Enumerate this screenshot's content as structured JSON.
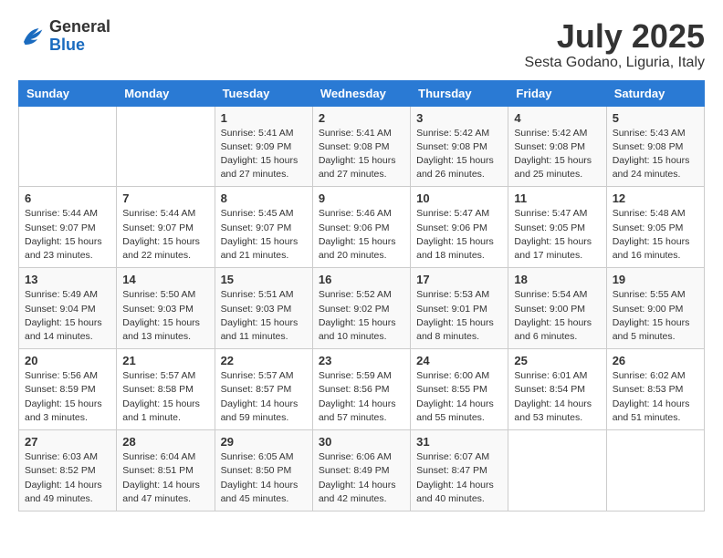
{
  "header": {
    "logo_general": "General",
    "logo_blue": "Blue",
    "month_title": "July 2025",
    "location": "Sesta Godano, Liguria, Italy"
  },
  "weekdays": [
    "Sunday",
    "Monday",
    "Tuesday",
    "Wednesday",
    "Thursday",
    "Friday",
    "Saturday"
  ],
  "weeks": [
    [
      {
        "day": "",
        "info": ""
      },
      {
        "day": "",
        "info": ""
      },
      {
        "day": "1",
        "info": "Sunrise: 5:41 AM\nSunset: 9:09 PM\nDaylight: 15 hours\nand 27 minutes."
      },
      {
        "day": "2",
        "info": "Sunrise: 5:41 AM\nSunset: 9:08 PM\nDaylight: 15 hours\nand 27 minutes."
      },
      {
        "day": "3",
        "info": "Sunrise: 5:42 AM\nSunset: 9:08 PM\nDaylight: 15 hours\nand 26 minutes."
      },
      {
        "day": "4",
        "info": "Sunrise: 5:42 AM\nSunset: 9:08 PM\nDaylight: 15 hours\nand 25 minutes."
      },
      {
        "day": "5",
        "info": "Sunrise: 5:43 AM\nSunset: 9:08 PM\nDaylight: 15 hours\nand 24 minutes."
      }
    ],
    [
      {
        "day": "6",
        "info": "Sunrise: 5:44 AM\nSunset: 9:07 PM\nDaylight: 15 hours\nand 23 minutes."
      },
      {
        "day": "7",
        "info": "Sunrise: 5:44 AM\nSunset: 9:07 PM\nDaylight: 15 hours\nand 22 minutes."
      },
      {
        "day": "8",
        "info": "Sunrise: 5:45 AM\nSunset: 9:07 PM\nDaylight: 15 hours\nand 21 minutes."
      },
      {
        "day": "9",
        "info": "Sunrise: 5:46 AM\nSunset: 9:06 PM\nDaylight: 15 hours\nand 20 minutes."
      },
      {
        "day": "10",
        "info": "Sunrise: 5:47 AM\nSunset: 9:06 PM\nDaylight: 15 hours\nand 18 minutes."
      },
      {
        "day": "11",
        "info": "Sunrise: 5:47 AM\nSunset: 9:05 PM\nDaylight: 15 hours\nand 17 minutes."
      },
      {
        "day": "12",
        "info": "Sunrise: 5:48 AM\nSunset: 9:05 PM\nDaylight: 15 hours\nand 16 minutes."
      }
    ],
    [
      {
        "day": "13",
        "info": "Sunrise: 5:49 AM\nSunset: 9:04 PM\nDaylight: 15 hours\nand 14 minutes."
      },
      {
        "day": "14",
        "info": "Sunrise: 5:50 AM\nSunset: 9:03 PM\nDaylight: 15 hours\nand 13 minutes."
      },
      {
        "day": "15",
        "info": "Sunrise: 5:51 AM\nSunset: 9:03 PM\nDaylight: 15 hours\nand 11 minutes."
      },
      {
        "day": "16",
        "info": "Sunrise: 5:52 AM\nSunset: 9:02 PM\nDaylight: 15 hours\nand 10 minutes."
      },
      {
        "day": "17",
        "info": "Sunrise: 5:53 AM\nSunset: 9:01 PM\nDaylight: 15 hours\nand 8 minutes."
      },
      {
        "day": "18",
        "info": "Sunrise: 5:54 AM\nSunset: 9:00 PM\nDaylight: 15 hours\nand 6 minutes."
      },
      {
        "day": "19",
        "info": "Sunrise: 5:55 AM\nSunset: 9:00 PM\nDaylight: 15 hours\nand 5 minutes."
      }
    ],
    [
      {
        "day": "20",
        "info": "Sunrise: 5:56 AM\nSunset: 8:59 PM\nDaylight: 15 hours\nand 3 minutes."
      },
      {
        "day": "21",
        "info": "Sunrise: 5:57 AM\nSunset: 8:58 PM\nDaylight: 15 hours\nand 1 minute."
      },
      {
        "day": "22",
        "info": "Sunrise: 5:57 AM\nSunset: 8:57 PM\nDaylight: 14 hours\nand 59 minutes."
      },
      {
        "day": "23",
        "info": "Sunrise: 5:59 AM\nSunset: 8:56 PM\nDaylight: 14 hours\nand 57 minutes."
      },
      {
        "day": "24",
        "info": "Sunrise: 6:00 AM\nSunset: 8:55 PM\nDaylight: 14 hours\nand 55 minutes."
      },
      {
        "day": "25",
        "info": "Sunrise: 6:01 AM\nSunset: 8:54 PM\nDaylight: 14 hours\nand 53 minutes."
      },
      {
        "day": "26",
        "info": "Sunrise: 6:02 AM\nSunset: 8:53 PM\nDaylight: 14 hours\nand 51 minutes."
      }
    ],
    [
      {
        "day": "27",
        "info": "Sunrise: 6:03 AM\nSunset: 8:52 PM\nDaylight: 14 hours\nand 49 minutes."
      },
      {
        "day": "28",
        "info": "Sunrise: 6:04 AM\nSunset: 8:51 PM\nDaylight: 14 hours\nand 47 minutes."
      },
      {
        "day": "29",
        "info": "Sunrise: 6:05 AM\nSunset: 8:50 PM\nDaylight: 14 hours\nand 45 minutes."
      },
      {
        "day": "30",
        "info": "Sunrise: 6:06 AM\nSunset: 8:49 PM\nDaylight: 14 hours\nand 42 minutes."
      },
      {
        "day": "31",
        "info": "Sunrise: 6:07 AM\nSunset: 8:47 PM\nDaylight: 14 hours\nand 40 minutes."
      },
      {
        "day": "",
        "info": ""
      },
      {
        "day": "",
        "info": ""
      }
    ]
  ]
}
